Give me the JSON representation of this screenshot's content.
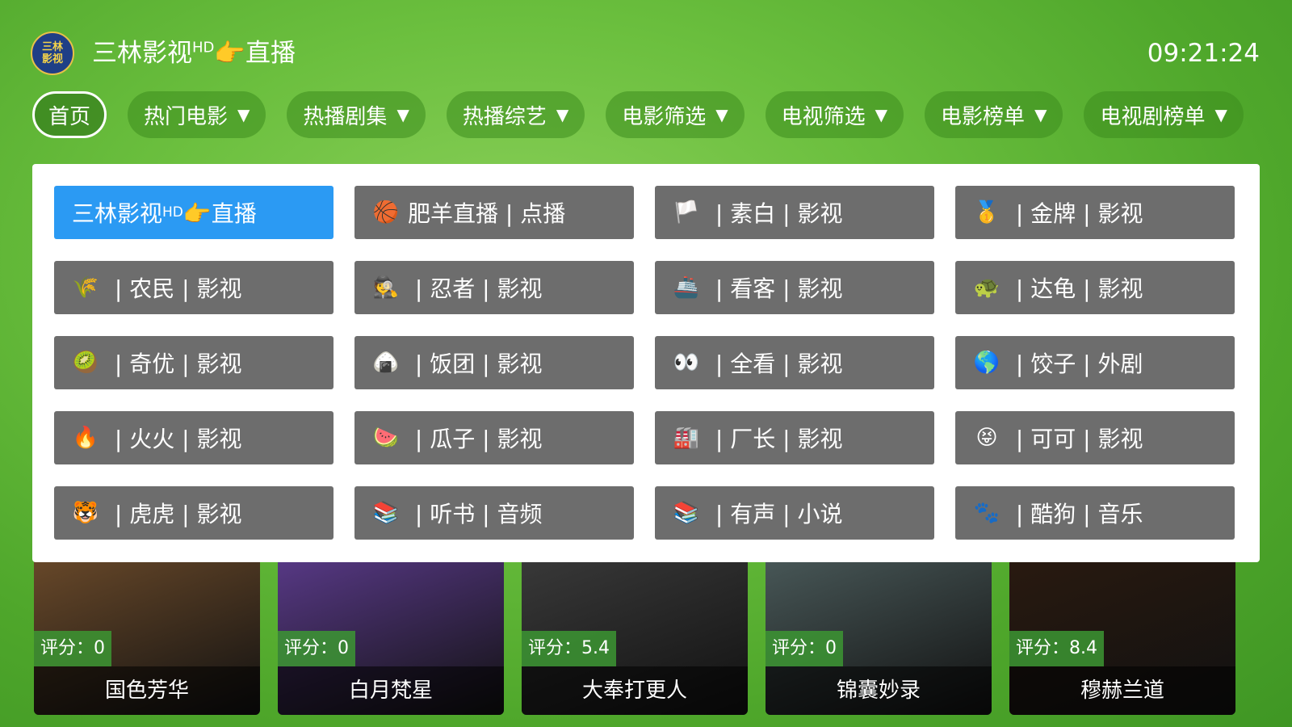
{
  "header": {
    "logo_line1": "三林",
    "logo_line2": "影视",
    "title_main": "三林影视",
    "title_sup": "HD",
    "title_tail": "👉直播",
    "clock": "09:21:24"
  },
  "tabs": [
    {
      "label": "首页",
      "filter": false
    },
    {
      "label": "热门电影",
      "filter": true
    },
    {
      "label": "热播剧集",
      "filter": true
    },
    {
      "label": "热播综艺",
      "filter": true
    },
    {
      "label": "电影筛选",
      "filter": true
    },
    {
      "label": "电视筛选",
      "filter": true
    },
    {
      "label": "电影榜单",
      "filter": true
    },
    {
      "label": "电视剧榜单",
      "filter": true
    }
  ],
  "filter_glyph": "▼",
  "sites": [
    {
      "icon": "",
      "label": "三林影视",
      "sup": "HD",
      "tail": "👉直播",
      "selected": true
    },
    {
      "icon": "🏀",
      "label": "肥羊直播 | 点播"
    },
    {
      "icon": "🏳️",
      "label": " | 素白 | 影视"
    },
    {
      "icon": "🥇",
      "label": " | 金牌 | 影视"
    },
    {
      "icon": "🌾",
      "label": " | 农民 | 影视"
    },
    {
      "icon": "🕵️",
      "label": " | 忍者 | 影视"
    },
    {
      "icon": "🚢",
      "label": " | 看客 | 影视"
    },
    {
      "icon": "🐢",
      "label": " | 达龟 | 影视"
    },
    {
      "icon": "🥝",
      "label": " | 奇优 | 影视"
    },
    {
      "icon": "🍙",
      "label": " | 饭团 | 影视"
    },
    {
      "icon": "👀",
      "label": " | 全看 | 影视"
    },
    {
      "icon": "🌎",
      "label": " | 饺子 | 外剧"
    },
    {
      "icon": "🔥",
      "label": " | 火火 | 影视"
    },
    {
      "icon": "🍉",
      "label": " | 瓜子 | 影视"
    },
    {
      "icon": "🏭",
      "label": " | 厂长 | 影视"
    },
    {
      "icon": "😝",
      "label": " | 可可 | 影视"
    },
    {
      "icon": "🐯",
      "label": " | 虎虎 | 影视"
    },
    {
      "icon": "📚",
      "label": " | 听书 | 音频"
    },
    {
      "icon": "📚",
      "label": " | 有声 | 小说"
    },
    {
      "icon": "🐾",
      "label": " | 酷狗 | 音乐"
    }
  ],
  "posters": [
    {
      "title": "国色芳华",
      "rating": "评分：0",
      "color": "#6b4a2a"
    },
    {
      "title": "白月梵星",
      "rating": "评分：0",
      "color": "#5a3a8a"
    },
    {
      "title": "大奉打更人",
      "rating": "评分：5.4",
      "color": "#3a3a3a"
    },
    {
      "title": "锦囊妙录",
      "rating": "评分：0",
      "color": "#4a5a5a"
    },
    {
      "title": "穆赫兰道",
      "rating": "评分：8.4",
      "color": "#2a1a10"
    }
  ]
}
